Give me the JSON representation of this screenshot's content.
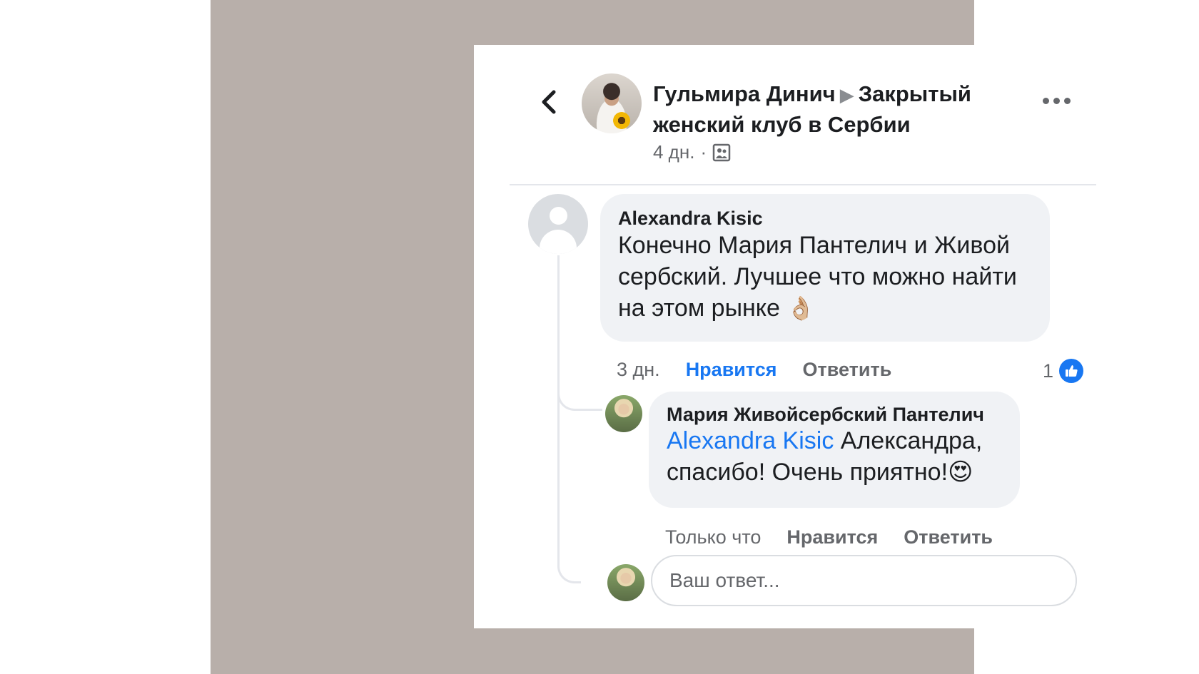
{
  "header": {
    "author_name": "Гульмира Динич",
    "arrow": "▶",
    "group_name": "Закрытый женский клуб в Сербии",
    "timestamp": "4 дн.",
    "separator": "·",
    "privacy_icon": "group-icon",
    "more_icon": "more-options-icon",
    "back_icon": "back-arrow-icon"
  },
  "comments": [
    {
      "author": "Alexandra Kisic",
      "text": "Конечно Мария Пантелич и Живой сербский. Лучшее что можно найти на этом рынке",
      "emoji": "👌🏼",
      "time": "3 дн.",
      "like_label": "Нравится",
      "reply_label": "Ответить",
      "reaction_count": "1",
      "liked": true
    },
    {
      "author": "Мария Живойсербский Пантелич",
      "mention": "Alexandra Kisic",
      "text": " Александра, спасибо! Очень приятно!",
      "emoji": "😍",
      "time": "Только что",
      "like_label": "Нравится",
      "reply_label": "Ответить"
    }
  ],
  "reply_box": {
    "placeholder": "Ваш ответ...",
    "value": ""
  },
  "colors": {
    "accent": "#1877f2",
    "bubble": "#f0f2f5",
    "frame": "#b8afaa"
  }
}
